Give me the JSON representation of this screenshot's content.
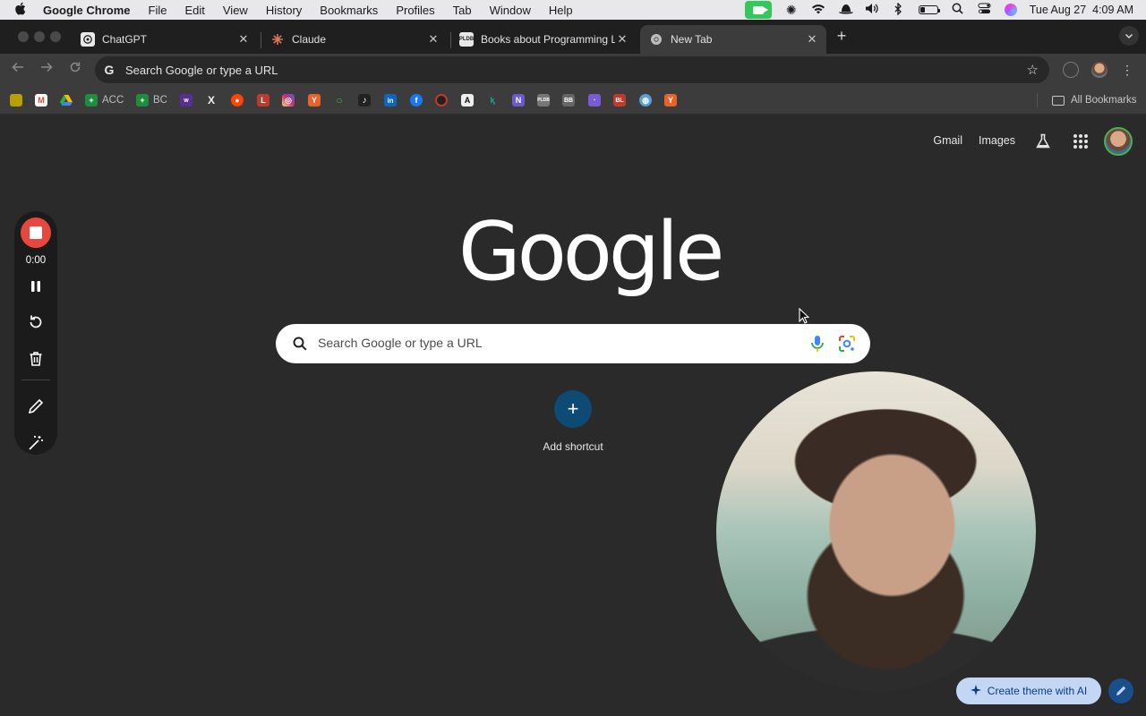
{
  "menubar": {
    "app_name": "Google Chrome",
    "items": [
      "File",
      "Edit",
      "View",
      "History",
      "Bookmarks",
      "Profiles",
      "Tab",
      "Window",
      "Help"
    ],
    "datetime": "Tue Aug 27  4:09 AM"
  },
  "tabs": [
    {
      "title": "ChatGPT",
      "favicon": "chatgpt-icon",
      "active": false
    },
    {
      "title": "Claude",
      "favicon": "claude-icon",
      "active": false
    },
    {
      "title": "Books about Programming La",
      "favicon": "pldb-icon",
      "active": false
    },
    {
      "title": "New Tab",
      "favicon": "chrome-icon",
      "active": true
    }
  ],
  "omnibox": {
    "placeholder": "Search Google or type a URL"
  },
  "bookmarks": {
    "items": [
      {
        "icon": "page-icon",
        "label": "",
        "color": "#b8a000"
      },
      {
        "icon": "gmail-icon",
        "label": "",
        "color": "#ea4335"
      },
      {
        "icon": "drive-icon",
        "label": "",
        "color": "#34a853"
      },
      {
        "icon": "sheets-icon",
        "label": "ACC",
        "color": "#1e8e3e"
      },
      {
        "icon": "sheets-icon",
        "label": "BC",
        "color": "#1e8e3e"
      },
      {
        "icon": "w-icon",
        "label": "",
        "color": "#5b2d91"
      },
      {
        "icon": "x-icon",
        "label": "",
        "color": "#333333"
      },
      {
        "icon": "reddit-icon",
        "label": "",
        "color": "#ff4500"
      },
      {
        "icon": "l-icon",
        "label": "",
        "color": "#c0392b"
      },
      {
        "icon": "instagram-icon",
        "label": "",
        "color": "#d62976"
      },
      {
        "icon": "y-icon",
        "label": "",
        "color": "#e8622c"
      },
      {
        "icon": "o-icon",
        "label": "",
        "color": "#4caf50"
      },
      {
        "icon": "tiktok-icon",
        "label": "",
        "color": "#222222"
      },
      {
        "icon": "linkedin-icon",
        "label": "",
        "color": "#0a66c2"
      },
      {
        "icon": "facebook-icon",
        "label": "",
        "color": "#1877f2"
      },
      {
        "icon": "target-icon",
        "label": "",
        "color": "#444444"
      },
      {
        "icon": "a-icon",
        "label": "",
        "color": "#eeeeee"
      },
      {
        "icon": "k-icon",
        "label": "",
        "color": "#2aa198"
      },
      {
        "icon": "n-icon",
        "label": "",
        "color": "#6a5acd"
      },
      {
        "icon": "pldb-icon",
        "label": "",
        "color": "#777777"
      },
      {
        "icon": "bb-icon",
        "label": "",
        "color": "#666666"
      },
      {
        "icon": "purple-icon",
        "label": "",
        "color": "#7b5ad6"
      },
      {
        "icon": "bl-icon",
        "label": "",
        "color": "#c0392b"
      },
      {
        "icon": "globe-icon",
        "label": "",
        "color": "#5aa0d8"
      },
      {
        "icon": "y-icon",
        "label": "",
        "color": "#e8622c"
      }
    ],
    "all_bookmarks": "All Bookmarks"
  },
  "ntp": {
    "links": [
      "Gmail",
      "Images"
    ],
    "search_placeholder": "Search Google or type a URL",
    "logo": "Google",
    "add_shortcut": "Add shortcut",
    "create_theme": "Create theme with AI"
  },
  "recorder": {
    "time": "0:00"
  },
  "colors": {
    "accent": "#8ab4f8",
    "record": "#e8473e",
    "shortcut": "#0d4a74"
  }
}
